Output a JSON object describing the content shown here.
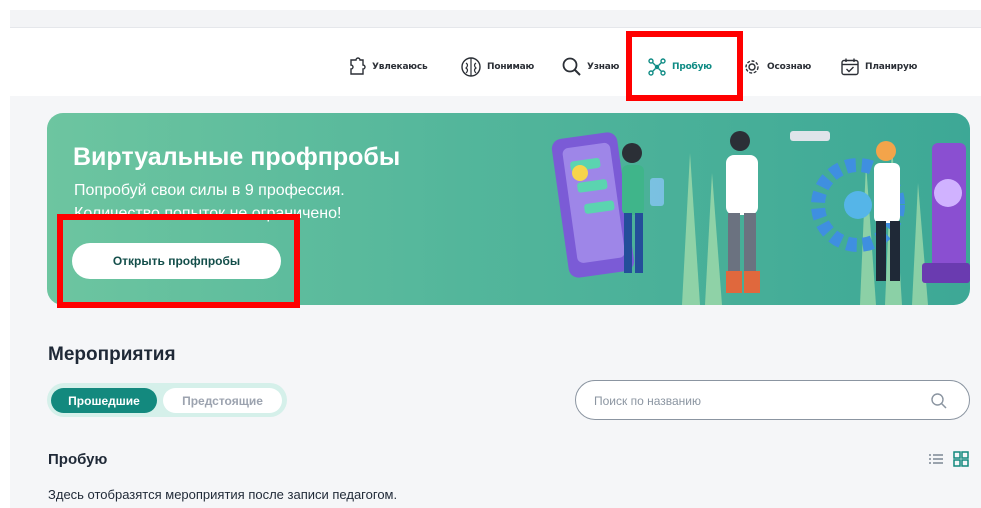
{
  "nav": {
    "items": [
      {
        "label": "Увлекаюсь",
        "icon": "puzzle-icon"
      },
      {
        "label": "Понимаю",
        "icon": "brain-icon"
      },
      {
        "label": "Узнаю",
        "icon": "magnifier-icon"
      },
      {
        "label": "Пробую",
        "icon": "molecule-icon",
        "active": true
      },
      {
        "label": "Осознаю",
        "icon": "gear-icon"
      },
      {
        "label": "Планирую",
        "icon": "calendar-check-icon"
      }
    ]
  },
  "banner": {
    "title": "Виртуальные профпробы",
    "subtitle_line1": "Попробуй свои силы в 9 профессия.",
    "subtitle_line2": "Количество попыток не ограничено!",
    "button_label": "Открыть профпробы"
  },
  "events": {
    "title": "Мероприятия",
    "toggle": {
      "past": "Прошедшие",
      "upcoming": "Предстоящие",
      "selected": "Прошедшие"
    },
    "search_placeholder": "Поиск по названию",
    "section_title": "Пробую",
    "empty_text": "Здесь отобразятся мероприятия после записи педагогом."
  },
  "colors": {
    "accent": "#13897e",
    "banner_start": "#6dc5a0",
    "banner_end": "#3da896",
    "highlight": "#ff0000",
    "active_nav": "#0e8b84"
  }
}
